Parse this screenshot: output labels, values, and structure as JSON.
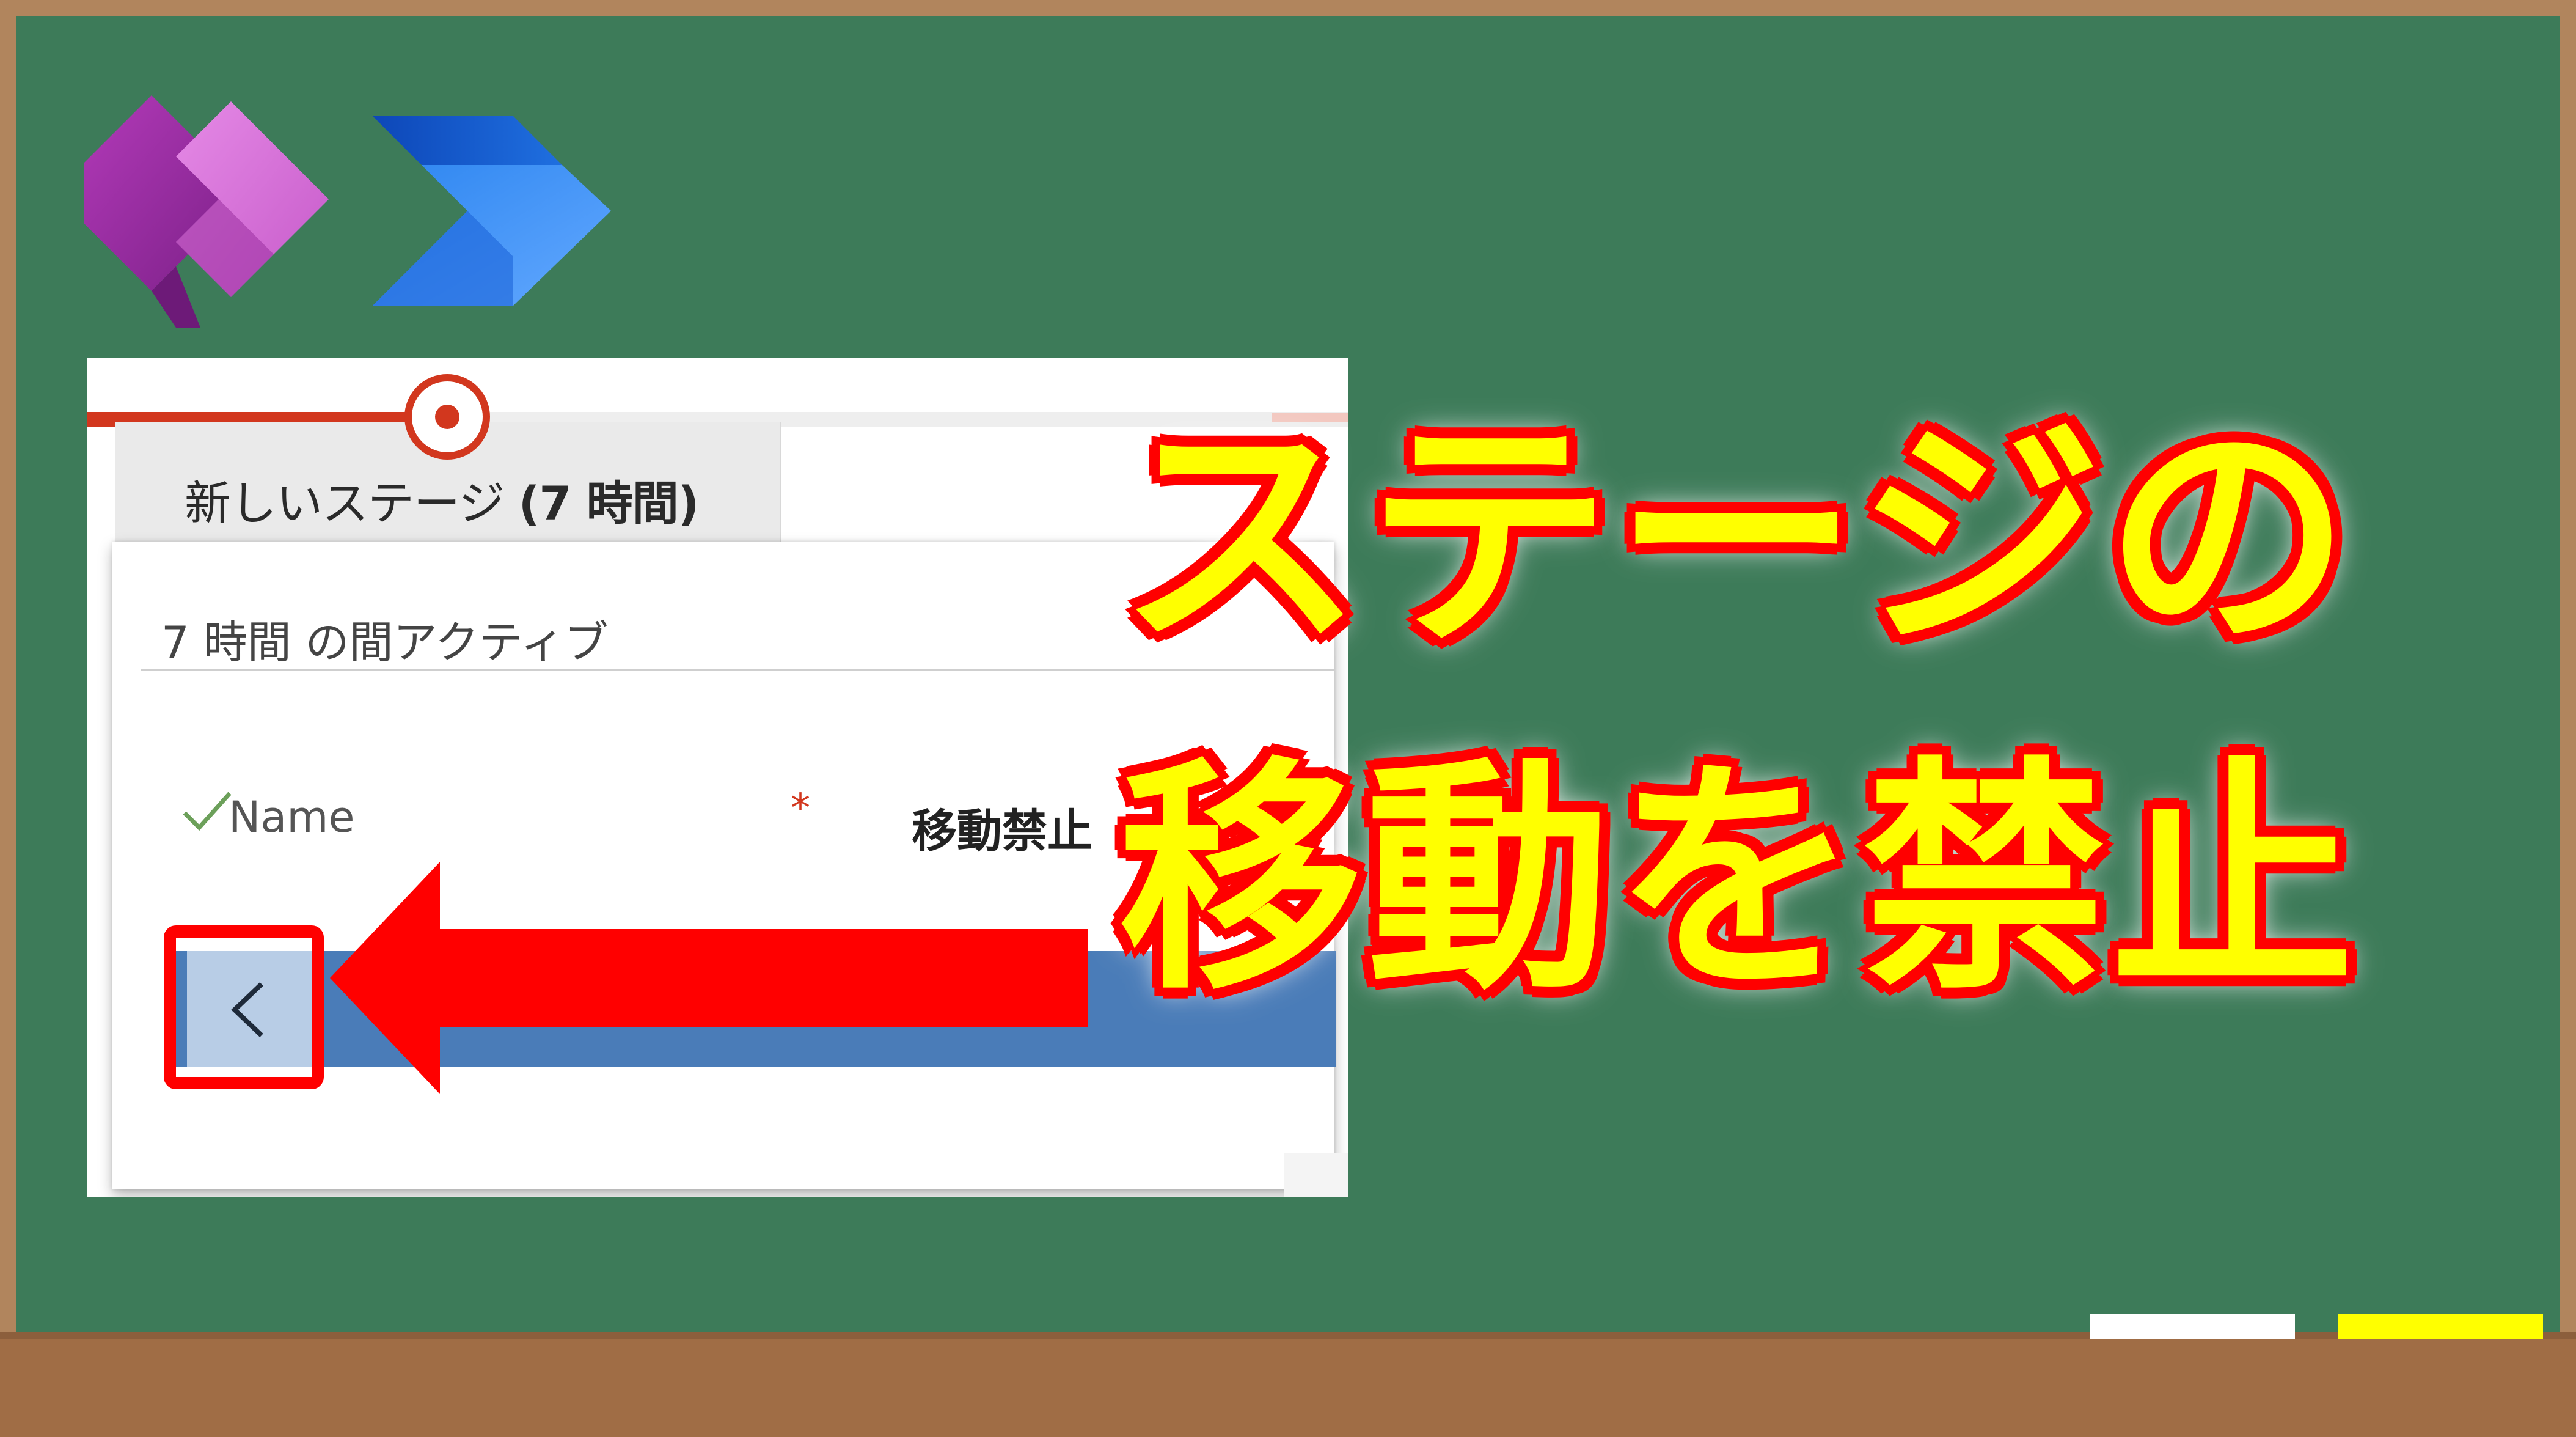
{
  "thumbnail": {
    "headline_line1": "ステージの",
    "headline_line2": "移動を禁止"
  },
  "logos": {
    "first_icon": "power-apps-icon",
    "second_icon": "power-automate-icon"
  },
  "bpf": {
    "stage_label": "新しいステージ",
    "stage_duration": "(7 時間)",
    "flyout_header": "7 時間 の間アクティブ",
    "field": {
      "name": "Name",
      "required_mark": "*",
      "value": "移動禁止"
    },
    "back_button_icon": "chevron-left-icon"
  },
  "colors": {
    "board": "#3d7b59",
    "frame": "#b1855d",
    "tray": "#a06d45",
    "accent_red": "#ff0000",
    "headline_yellow": "#ffff00",
    "stage_red": "#d2371e",
    "action_bar_blue": "#4a7cb8"
  }
}
